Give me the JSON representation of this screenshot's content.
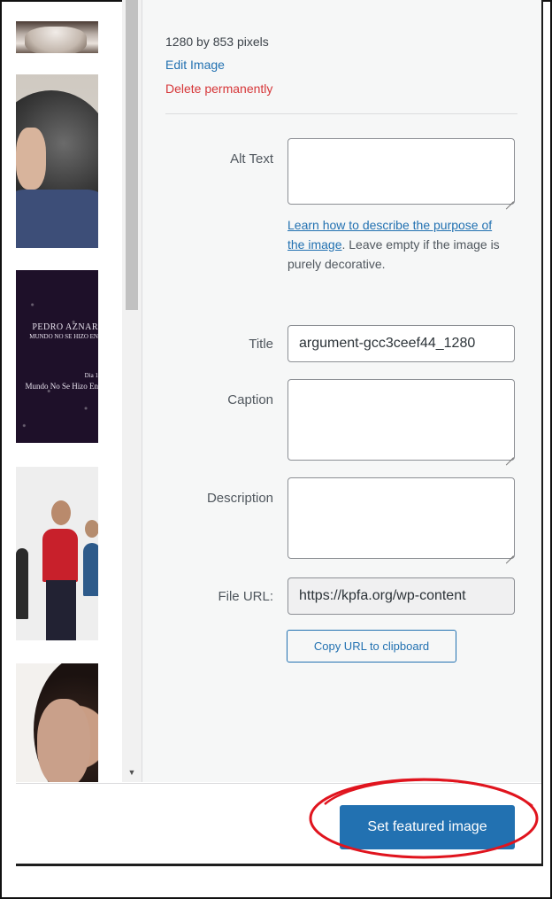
{
  "attachment": {
    "dimensions": "1280 by 853 pixels",
    "edit_label": "Edit Image",
    "delete_label": "Delete permanently"
  },
  "fields": {
    "alt_text": {
      "label": "Alt Text",
      "value": ""
    },
    "alt_help": {
      "link_text": "Learn how to describe the purpose of the image",
      "suffix": ". Leave empty if the image is purely decorative."
    },
    "title": {
      "label": "Title",
      "value": "argument-gcc3ceef44_1280"
    },
    "caption": {
      "label": "Caption",
      "value": ""
    },
    "description": {
      "label": "Description",
      "value": ""
    },
    "file_url": {
      "label": "File URL:",
      "value": "https://kpfa.org/wp-content"
    },
    "copy_label": "Copy URL to clipboard"
  },
  "thumbnails": {
    "poster": {
      "line1": "PEDRO AZNAR",
      "line2": "MUNDO NO SE HIZO EN",
      "line3": "Dia 1",
      "line4": "Mundo No Se Hizo En"
    }
  },
  "toolbar": {
    "primary_label": "Set featured image"
  },
  "colors": {
    "primary": "#2271b1",
    "danger": "#d63638",
    "annotation": "#e0141e"
  }
}
